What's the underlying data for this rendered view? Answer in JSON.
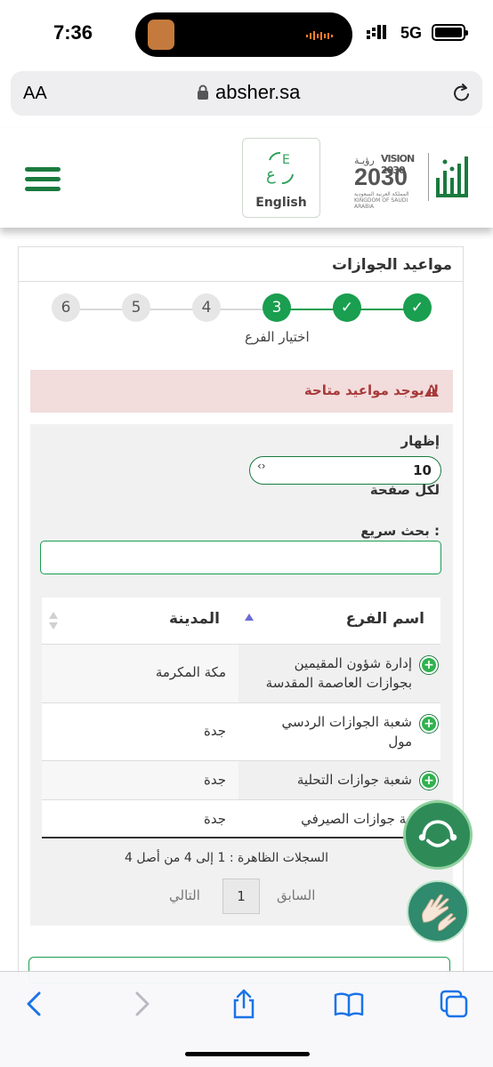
{
  "status_bar": {
    "time": "7:36",
    "network": "5G"
  },
  "browser": {
    "text_size_label": "AA",
    "url": "absher.sa"
  },
  "header": {
    "language_button_label": "English",
    "vision_small": "رؤيـة",
    "vision_big": "VISION 2030",
    "vision_sub": "المملكة العربية السعودية KINGDOM OF SAUDI ARABIA"
  },
  "page": {
    "title": "مواعيد الجوازات",
    "steps": [
      {
        "label": "6",
        "state": "todo"
      },
      {
        "label": "5",
        "state": "todo"
      },
      {
        "label": "4",
        "state": "todo"
      },
      {
        "label": "3",
        "state": "active"
      },
      {
        "label": "✓",
        "state": "done"
      },
      {
        "label": "✓",
        "state": "done"
      }
    ],
    "active_step_label": "اختيار الفرع",
    "alert": {
      "text": "لا يوجد مواعيد متاحة",
      "color": "#a83a3a",
      "background": "#f2dcdc"
    }
  },
  "table_controls": {
    "show_label": "إظهار",
    "per_page_value": "10",
    "per_page_suffix": "لكل صفحة",
    "search_label": "بحث سريع :",
    "search_value": ""
  },
  "table": {
    "headers": {
      "branch": "اسم الفرع",
      "city": "المدينة"
    },
    "rows": [
      {
        "branch": "إدارة شؤون المقيمين بجوازات العاصمة المقدسة",
        "city": "مكة المكرمة"
      },
      {
        "branch": "شعبة الجوازات الردسي مول",
        "city": "جدة"
      },
      {
        "branch": "شعبة جوازات التحلية",
        "city": "جدة"
      },
      {
        "branch": "شعبة جوازات الصيرفي",
        "city": "جدة"
      }
    ],
    "info": "السجلات الظاهرة : 1 إلى 4 من أصل 4",
    "pagination": {
      "previous": "السابق",
      "page": "1",
      "next": "التالي"
    }
  },
  "colors": {
    "brand_green": "#1a9e4f",
    "dark_green": "#1a7a3e"
  },
  "icons": [
    "hamburger-menu-icon",
    "language-icon",
    "lock-icon",
    "reload-icon",
    "warning-icon",
    "expand-plus-icon",
    "chat-bot-icon",
    "sign-language-icon",
    "back-icon",
    "forward-icon",
    "share-icon",
    "bookmarks-icon",
    "tabs-icon"
  ]
}
